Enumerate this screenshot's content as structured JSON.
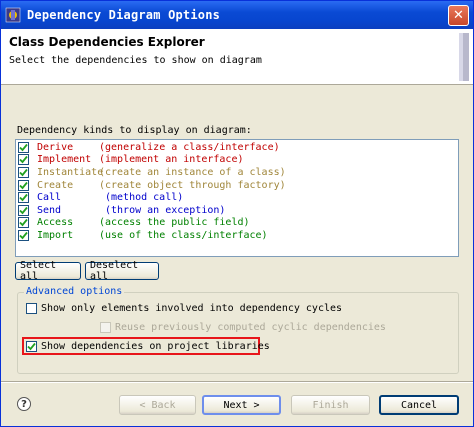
{
  "window": {
    "title": "Dependency Diagram Options",
    "close_label": "✕"
  },
  "header": {
    "title": "Class Dependencies Explorer",
    "description": "Select the dependencies to show on diagram"
  },
  "dependency_kinds": {
    "label": "Dependency kinds to display on diagram:",
    "items": [
      {
        "name": "Derive",
        "desc": "(generalize a class/interface)",
        "checked": true,
        "color": "#c00000"
      },
      {
        "name": "Implement",
        "desc": "(implement an interface)",
        "checked": true,
        "color": "#c00000"
      },
      {
        "name": "Instantiate",
        "desc": "(create an instance of a class)",
        "checked": true,
        "color": "#a0863a"
      },
      {
        "name": "Create",
        "desc": "(create object through factory)",
        "checked": true,
        "color": "#a0863a"
      },
      {
        "name": "Call",
        "desc": "(method call)",
        "checked": true,
        "color": "#0000cc"
      },
      {
        "name": "Send",
        "desc": "(throw an exception)",
        "checked": true,
        "color": "#0000cc"
      },
      {
        "name": "Access",
        "desc": "(access the public field)",
        "checked": true,
        "color": "#008000"
      },
      {
        "name": "Import",
        "desc": "(use of the class/interface)",
        "checked": true,
        "color": "#008000"
      }
    ],
    "select_all_label": "Select all",
    "deselect_all_label": "Deselect all"
  },
  "advanced": {
    "legend": "Advanced options",
    "cycles_label": "Show only elements involved into dependency cycles",
    "cycles_checked": false,
    "reuse_label": "Reuse previously computed cyclic dependencies",
    "reuse_checked": false,
    "libraries_label": "Show dependencies on project libraries",
    "libraries_checked": true
  },
  "footer": {
    "help_label": "?",
    "back_label": "< Back",
    "next_label": "Next >",
    "finish_label": "Finish",
    "cancel_label": "Cancel"
  },
  "colors": {
    "titlebar": "#0a4ad4",
    "highlight": "#e8161a",
    "check": "#21a121"
  }
}
